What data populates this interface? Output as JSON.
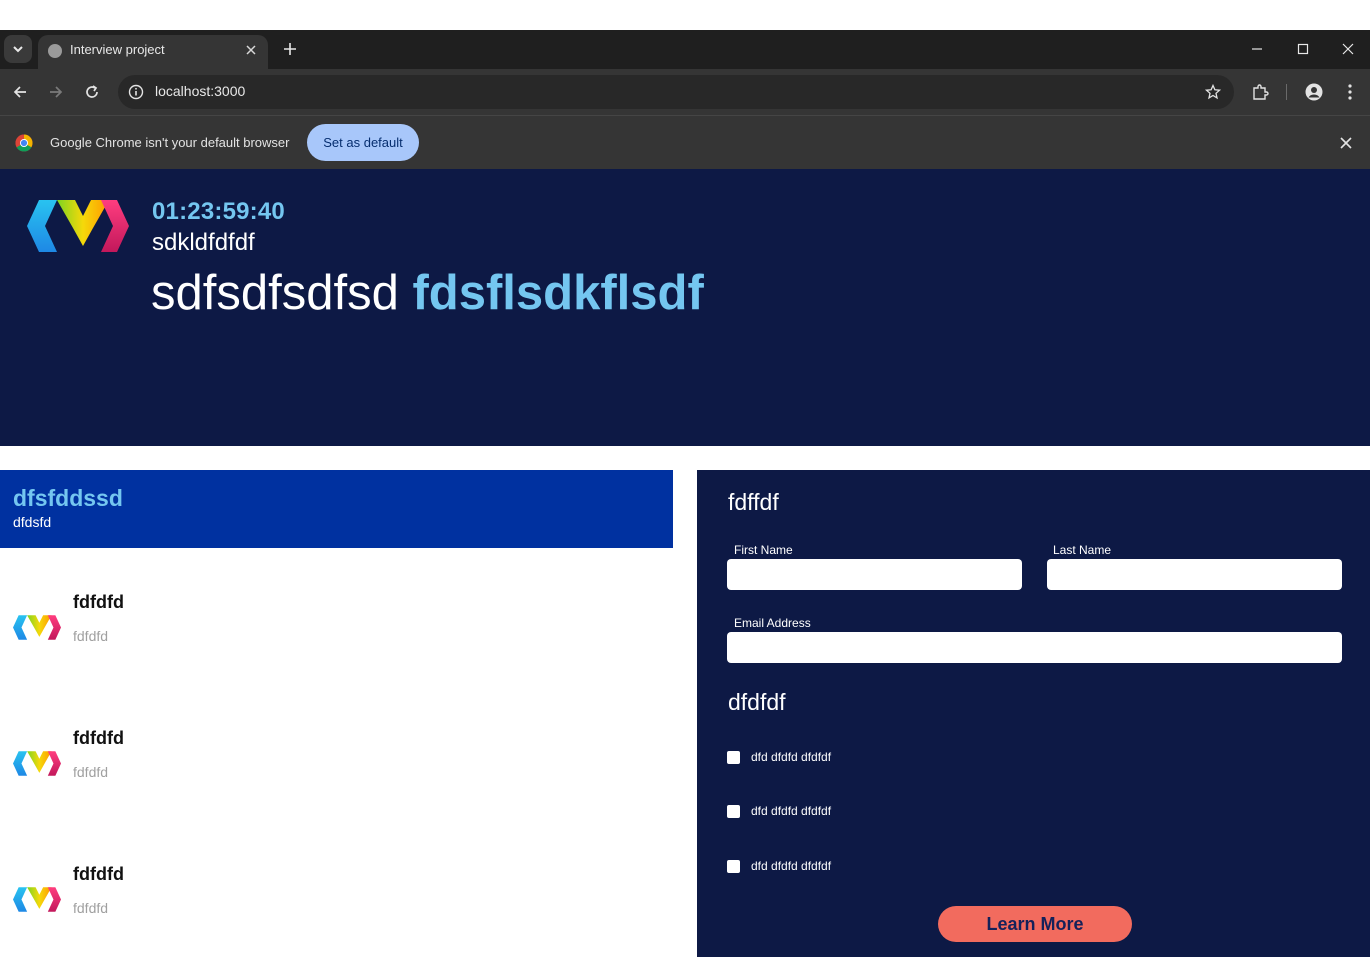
{
  "browser": {
    "tab_title": "Interview project",
    "url": "localhost:3000",
    "infobar_text": "Google Chrome isn't your default browser",
    "set_default_label": "Set as default"
  },
  "hero": {
    "timer": "01:23:59:40",
    "subtitle": "sdkldfdfdf",
    "title_plain": "sdfsdfsdfsd",
    "title_accent": "fdsflsdkflsdf"
  },
  "left_panel": {
    "header_title": "dfsfddssd",
    "header_sub": "dfdsfd",
    "items": [
      {
        "title": "fdfdfd",
        "sub": "fdfdfd"
      },
      {
        "title": "fdfdfd",
        "sub": "fdfdfd"
      },
      {
        "title": "fdfdfd",
        "sub": "fdfdfd"
      }
    ]
  },
  "form": {
    "heading": "fdffdf",
    "first_name_label": "First Name",
    "last_name_label": "Last Name",
    "email_label": "Email Address",
    "first_name_value": "",
    "last_name_value": "",
    "email_value": "",
    "section_heading": "dfdfdf",
    "checkboxes": [
      {
        "label": "dfd dfdfd dfdfdf",
        "checked": false
      },
      {
        "label": "dfd dfdfd dfdfdf",
        "checked": false
      },
      {
        "label": "dfd dfdfd dfdfdf",
        "checked": false
      }
    ],
    "button_label": "Learn More"
  },
  "colors": {
    "navy": "#0d1945",
    "blue_header": "#0031a0",
    "accent_light_blue": "#74c6f0",
    "button_coral": "#f26b5e"
  }
}
